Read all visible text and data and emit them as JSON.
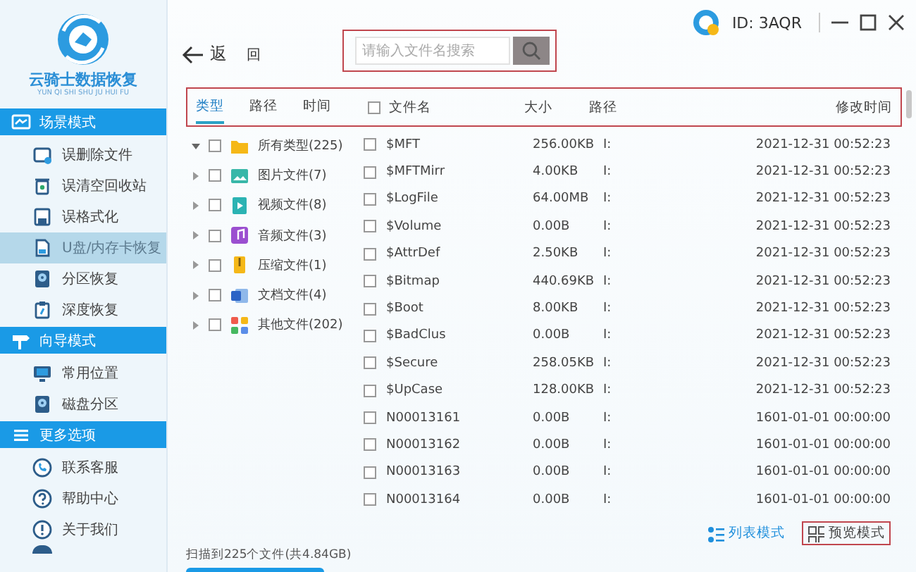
{
  "app": {
    "title": "云骑士数据恢复",
    "subtitle": "YUN QI SHI SHU JU HUI FU"
  },
  "sidebar": {
    "sections": [
      {
        "title": "场景模式",
        "kind": "scene",
        "items": [
          {
            "label": "误删除文件",
            "kind": "doc",
            "selected": false
          },
          {
            "label": "误清空回收站",
            "kind": "bin",
            "selected": false
          },
          {
            "label": "误格式化",
            "kind": "disk",
            "selected": false
          },
          {
            "label": "U盘/内存卡恢复",
            "kind": "card",
            "selected": true
          },
          {
            "label": "分区恢复",
            "kind": "drive",
            "selected": false
          },
          {
            "label": "深度恢复",
            "kind": "clip",
            "selected": false
          }
        ]
      },
      {
        "title": "向导模式",
        "kind": "sign",
        "items": [
          {
            "label": "常用位置",
            "kind": "monitor",
            "selected": false
          },
          {
            "label": "磁盘分区",
            "kind": "drive",
            "selected": false
          }
        ]
      },
      {
        "title": "更多选项",
        "kind": "menu",
        "items": [
          {
            "label": "联系客服",
            "kind": "phone",
            "selected": false
          },
          {
            "label": "帮助中心",
            "kind": "help",
            "selected": false
          },
          {
            "label": "关于我们",
            "kind": "info",
            "selected": false
          }
        ]
      }
    ]
  },
  "toolbar": {
    "back_label": "返",
    "back_label_2": "回",
    "search": {
      "placeholder": "请输入文件名搜索"
    },
    "user_id": "ID: 3AQR"
  },
  "tabs": [
    {
      "label": "类型",
      "selected": true
    },
    {
      "label": "路径",
      "selected": false
    },
    {
      "label": "时间",
      "selected": false
    }
  ],
  "table": {
    "columns": [
      "文件名",
      "大小",
      "路径",
      "修改时间"
    ],
    "header_checked": false,
    "rows": [
      {
        "name": "$MFT",
        "size": "256.00KB",
        "path": "I:",
        "modified": "2021-12-31 00:52:23",
        "checked": false
      },
      {
        "name": "$MFTMirr",
        "size": "4.00KB",
        "path": "I:",
        "modified": "2021-12-31 00:52:23",
        "checked": false
      },
      {
        "name": "$LogFile",
        "size": "64.00MB",
        "path": "I:",
        "modified": "2021-12-31 00:52:23",
        "checked": false
      },
      {
        "name": "$Volume",
        "size": "0.00B",
        "path": "I:",
        "modified": "2021-12-31 00:52:23",
        "checked": false
      },
      {
        "name": "$AttrDef",
        "size": "2.50KB",
        "path": "I:",
        "modified": "2021-12-31 00:52:23",
        "checked": false
      },
      {
        "name": "$Bitmap",
        "size": "440.69KB",
        "path": "I:",
        "modified": "2021-12-31 00:52:23",
        "checked": false
      },
      {
        "name": "$Boot",
        "size": "8.00KB",
        "path": "I:",
        "modified": "2021-12-31 00:52:23",
        "checked": false
      },
      {
        "name": "$BadClus",
        "size": "0.00B",
        "path": "I:",
        "modified": "2021-12-31 00:52:23",
        "checked": false
      },
      {
        "name": "$Secure",
        "size": "258.05KB",
        "path": "I:",
        "modified": "2021-12-31 00:52:23",
        "checked": false
      },
      {
        "name": "$UpCase",
        "size": "128.00KB",
        "path": "I:",
        "modified": "2021-12-31 00:52:23",
        "checked": false
      },
      {
        "name": "N00013161",
        "size": "0.00B",
        "path": "I:",
        "modified": "1601-01-01 00:00:00",
        "checked": false
      },
      {
        "name": "N00013162",
        "size": "0.00B",
        "path": "I:",
        "modified": "1601-01-01 00:00:00",
        "checked": false
      },
      {
        "name": "N00013163",
        "size": "0.00B",
        "path": "I:",
        "modified": "1601-01-01 00:00:00",
        "checked": false
      },
      {
        "name": "N00013164",
        "size": "0.00B",
        "path": "I:",
        "modified": "1601-01-01 00:00:00",
        "checked": false
      }
    ]
  },
  "tree": [
    {
      "label": "所有类型(225)",
      "kind": "folder",
      "expanded": true,
      "checked": false,
      "children": [
        {
          "label": "图片文件(7)",
          "kind": "image",
          "expanded": false,
          "checked": false
        },
        {
          "label": "视频文件(8)",
          "kind": "video",
          "expanded": false,
          "checked": false
        },
        {
          "label": "音频文件(3)",
          "kind": "audio",
          "expanded": false,
          "checked": false
        },
        {
          "label": "压缩文件(1)",
          "kind": "archive",
          "expanded": false,
          "checked": false
        },
        {
          "label": "文档文件(4)",
          "kind": "document",
          "expanded": false,
          "checked": false
        },
        {
          "label": "其他文件(202)",
          "kind": "other",
          "expanded": false,
          "checked": false
        }
      ]
    }
  ],
  "view_modes": [
    {
      "label": "列表模式",
      "kind": "list",
      "selected": true
    },
    {
      "label": "预览模式",
      "kind": "grid",
      "selected": false
    }
  ],
  "status_bar": {
    "text": "扫描到225个文件(共4.84GB)"
  }
}
